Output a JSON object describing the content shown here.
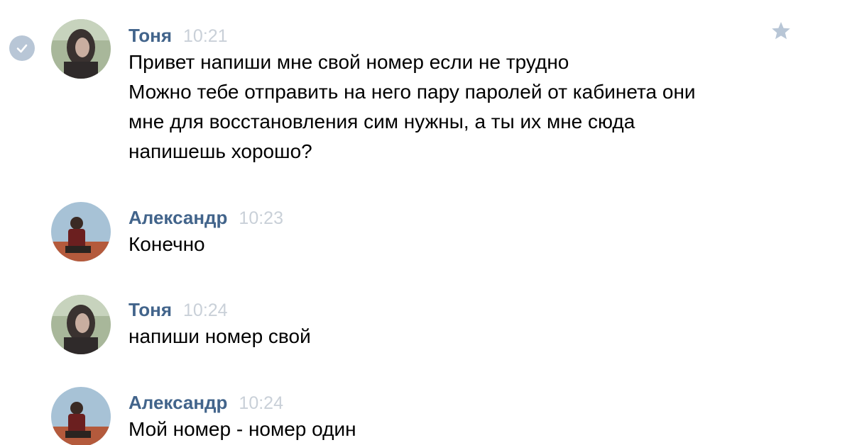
{
  "colors": {
    "author": "#42648b",
    "time": "#c9d0d8",
    "text": "#000000",
    "check_bg": "#b8c6d6",
    "star": "#b8c6d6"
  },
  "icons": {
    "selected": "check-circle-icon",
    "favorite": "star-icon"
  },
  "messages": [
    {
      "author": "Тоня",
      "time": "10:21",
      "avatar": "avatar-tonya",
      "lines": [
        "Привет напиши мне свой номер если не трудно",
        "Можно тебе отправить на него пару паролей от кабинета они",
        "мне для восстановления сим нужны, а ты их мне сюда",
        "напишешь хорошо?"
      ]
    },
    {
      "author": "Александр",
      "time": "10:23",
      "avatar": "avatar-aleksandr",
      "lines": [
        "Конечно"
      ]
    },
    {
      "author": "Тоня",
      "time": "10:24",
      "avatar": "avatar-tonya",
      "lines": [
        "напиши номер свой"
      ]
    },
    {
      "author": "Александр",
      "time": "10:24",
      "avatar": "avatar-aleksandr",
      "lines": [
        "Мой номер - номер один"
      ]
    }
  ]
}
